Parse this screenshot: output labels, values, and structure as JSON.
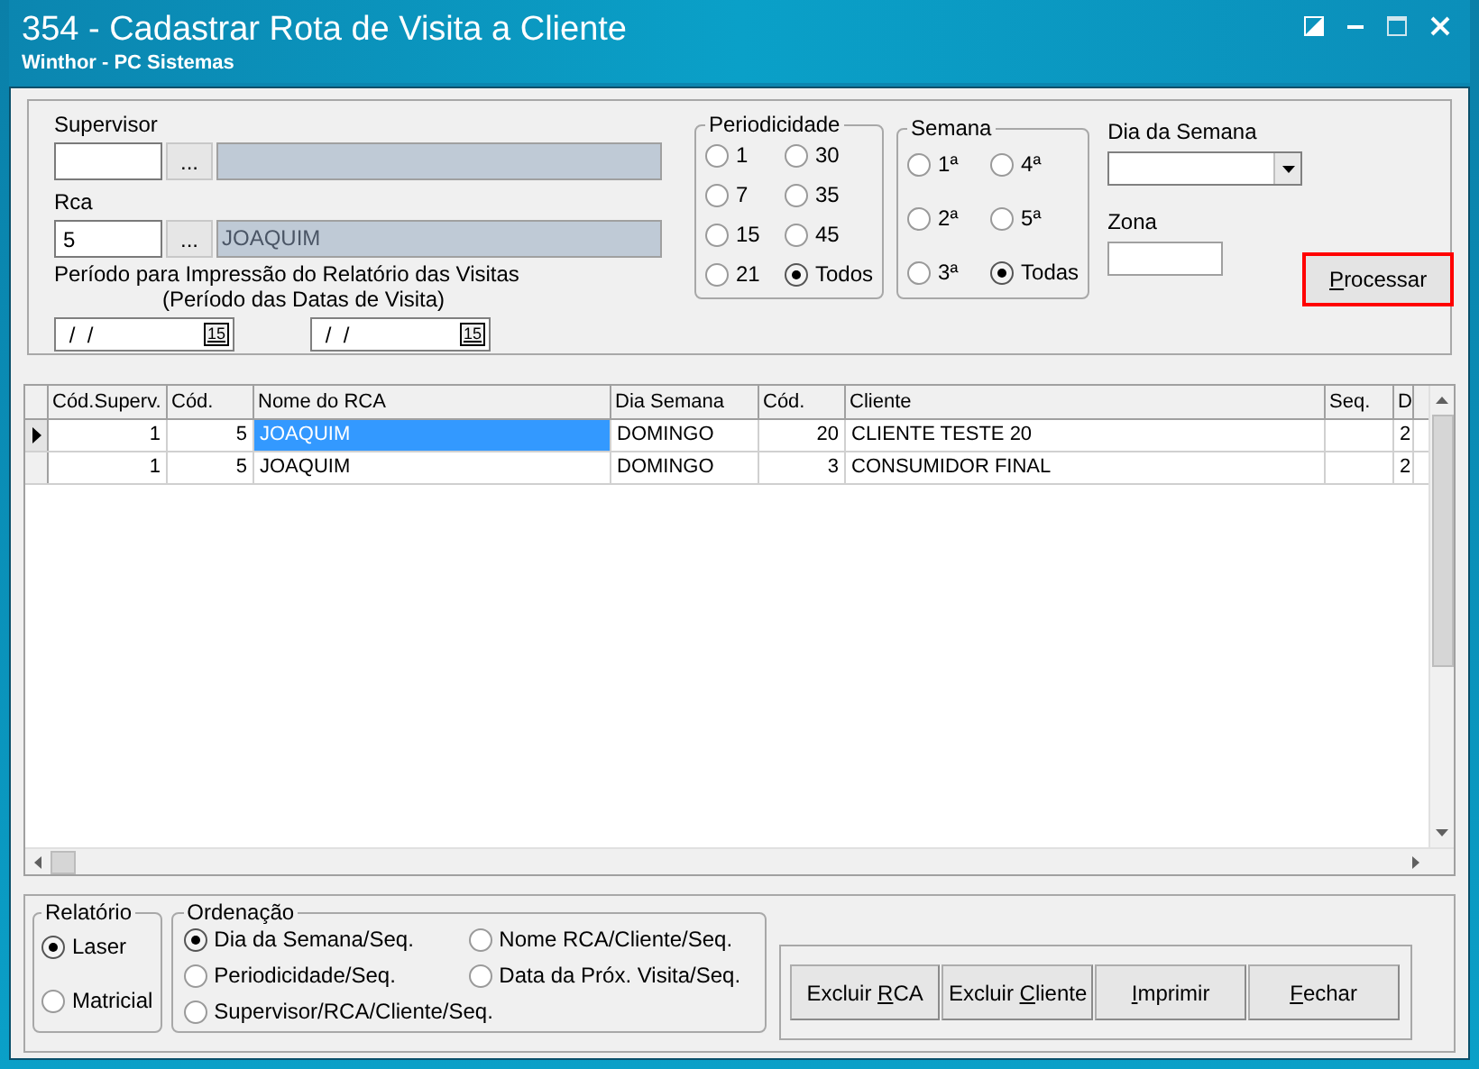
{
  "window": {
    "title": "354 - Cadastrar Rota de Visita a Cliente",
    "subtitle": "Winthor - PC Sistemas"
  },
  "filters": {
    "supervisor": {
      "label": "Supervisor",
      "lookup": "..."
    },
    "rca": {
      "label": "Rca",
      "code": "5",
      "name": "JOAQUIM",
      "lookup": "..."
    },
    "period_label": "Período para Impressão do Relatório das Visitas",
    "period_sublabel": "(Período das Datas de Visita)",
    "dates": [
      {
        "value": " /  /",
        "calendar": "15"
      },
      {
        "value": " /  /",
        "calendar": "15"
      }
    ]
  },
  "periodicidade": {
    "title": "Periodicidade",
    "options": [
      {
        "label": "1",
        "selected": false
      },
      {
        "label": "30",
        "selected": false
      },
      {
        "label": "7",
        "selected": false
      },
      {
        "label": "35",
        "selected": false
      },
      {
        "label": "15",
        "selected": false
      },
      {
        "label": "45",
        "selected": false
      },
      {
        "label": "21",
        "selected": false
      },
      {
        "label": "Todos",
        "selected": true
      }
    ]
  },
  "semana": {
    "title": "Semana",
    "options": [
      {
        "label": "1ª",
        "selected": false
      },
      {
        "label": "4ª",
        "selected": false
      },
      {
        "label": "2ª",
        "selected": false
      },
      {
        "label": "5ª",
        "selected": false
      },
      {
        "label": "3ª",
        "selected": false
      },
      {
        "label": "Todas",
        "selected": true
      }
    ]
  },
  "dia_da_semana": {
    "label": "Dia da Semana"
  },
  "zona": {
    "label": "Zona"
  },
  "process_button": {
    "key": "P",
    "after": "rocessar",
    "highlighted": true
  },
  "table": {
    "columns": [
      "Cód.Superv.",
      "Cód.",
      "Nome do RCA",
      "Dia Semana",
      "Cód.",
      "Cliente",
      "Seq.",
      "D"
    ],
    "rows": [
      {
        "selected": true,
        "cells": [
          "1",
          "5",
          "JOAQUIM",
          "DOMINGO",
          "20",
          "CLIENTE TESTE 20",
          "",
          "2"
        ]
      },
      {
        "selected": false,
        "cells": [
          "1",
          "5",
          "JOAQUIM",
          "DOMINGO",
          "3",
          "CONSUMIDOR FINAL",
          "",
          "2"
        ]
      }
    ]
  },
  "relatorio": {
    "title": "Relatório",
    "options": [
      {
        "label": "Laser",
        "selected": true
      },
      {
        "label": "Matricial",
        "selected": false
      }
    ]
  },
  "ordenacao": {
    "title": "Ordenação",
    "options": [
      {
        "label": "Dia da Semana/Seq.",
        "selected": true
      },
      {
        "label": "Nome RCA/Cliente/Seq.",
        "selected": false
      },
      {
        "label": "Periodicidade/Seq.",
        "selected": false
      },
      {
        "label": "Data da Próx. Visita/Seq.",
        "selected": false
      },
      {
        "label": "Supervisor/RCA/Cliente/Seq.",
        "selected": false
      }
    ]
  },
  "buttons": [
    {
      "before": "Excluir ",
      "key": "R",
      "after": "CA"
    },
    {
      "before": "Excluir ",
      "key": "C",
      "after": "liente"
    },
    {
      "key": "I",
      "after": "mprimir"
    },
    {
      "key": "F",
      "after": "echar"
    }
  ]
}
